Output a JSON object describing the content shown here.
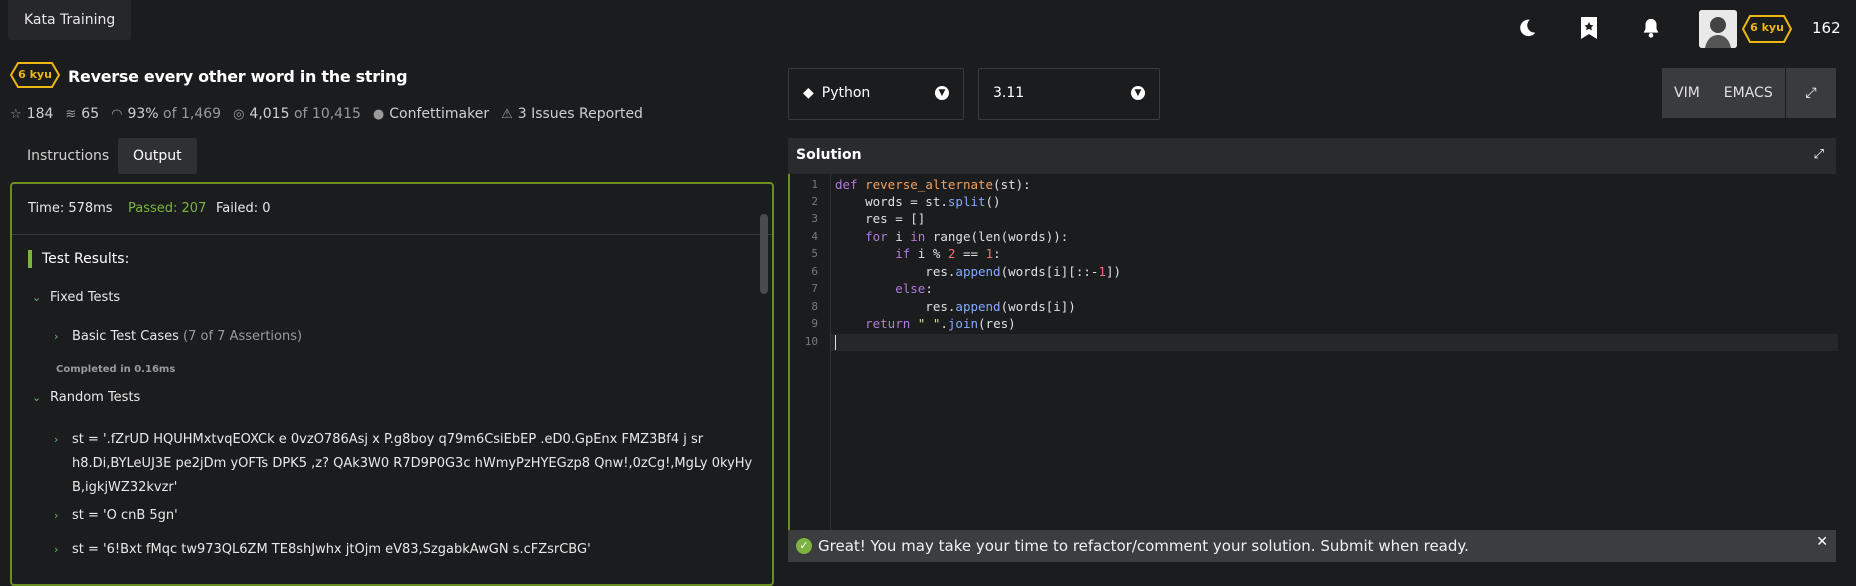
{
  "topbar": {
    "brand": "Kata Training",
    "icons": [
      "moon-icon",
      "bookmark-icon",
      "bell-icon"
    ],
    "user_rank": "6 kyu",
    "honor": "162"
  },
  "kata": {
    "rank": "6 kyu",
    "title": "Reverse every other word in the string",
    "stars": "184",
    "collections": "65",
    "satisfaction": "93%",
    "satisfaction_of": "of 1,469",
    "completed": "4,015",
    "completed_of": "of 10,415",
    "author": "Confettimaker",
    "issues": "3 Issues Reported"
  },
  "tabs": {
    "instructions": "Instructions",
    "output": "Output"
  },
  "output": {
    "time": "Time: 578ms",
    "passed": "Passed: 207",
    "failed": "Failed: 0",
    "results_title": "Test Results:",
    "fixed_tests": "Fixed Tests",
    "basic_cases": "Basic Test Cases",
    "basic_assertions": "(7 of 7 Assertions)",
    "completed_in": "Completed in 0.16ms",
    "random_tests": "Random Tests",
    "random_items": [
      "st = '.fZrUD HQUHMxtvqEOXCk e 0vzO786Asj x P.g8boy q79m6CsiEbEP .eD0.GpEnx FMZ3Bf4 j sr",
      "h8.Di,BYLeUJ3E pe2jDm yOFTs DPK5 ,z? QAk3W0 R7D9P0G3c hWmyPzHYEGzp8 Qnw!,0zCg!,MgLy 0kyHy",
      "B,igkjWZ32kvzr'",
      "st = 'O cnB 5gn'",
      "st = '6!Bxt fMqc tw973QL6ZM TE8shJwhx jtOjm eV83,SzgabkAwGN s.cFZsrCBG'"
    ]
  },
  "language": {
    "selected": "Python",
    "version": "3.11"
  },
  "editor_modes": [
    "VIM",
    "EMACS"
  ],
  "solution": {
    "title": "Solution",
    "line_numbers": [
      "1",
      "2",
      "3",
      "4",
      "5",
      "6",
      "7",
      "8",
      "9",
      "10"
    ]
  },
  "banner": {
    "message": "Great! You may take your time to refactor/comment your solution. Submit when ready."
  }
}
